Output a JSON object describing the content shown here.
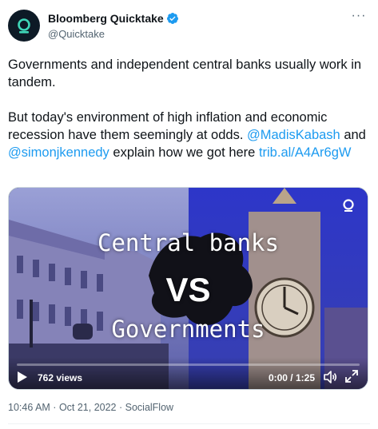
{
  "author": {
    "display_name": "Bloomberg Quicktake",
    "handle": "@Quicktake",
    "avatar_icon": "quicktake-logo-icon",
    "verified": true,
    "verified_color": "#1d9bf0"
  },
  "tweet": {
    "paragraph_1": "Governments and independent central banks usually work in tandem.",
    "paragraph_2_text": "But today's environment of high inflation and economic recession have them seemingly at odds. ",
    "mention_1": "@MadisKabash",
    "and_text": " and ",
    "mention_2": "@simonjkennedy",
    "explain_text": " explain how we got here ",
    "link": "trib.al/A4Ar6gW",
    "link_color": "#1d9bf0"
  },
  "video": {
    "overlay_line_1": "Central banks",
    "overlay_line_2": "VS",
    "overlay_line_3": "Governments",
    "views": "762 views",
    "time": "0:00 / 1:25",
    "progress_fraction": 0.0,
    "play_icon": "play-icon",
    "volume_icon": "volume-icon",
    "fullscreen_icon": "fullscreen-icon"
  },
  "meta": {
    "time": "10:46 AM",
    "sep1": " · ",
    "date": "Oct 21, 2022",
    "sep2": " · ",
    "source": "SocialFlow"
  },
  "more_icon": "more-icon"
}
